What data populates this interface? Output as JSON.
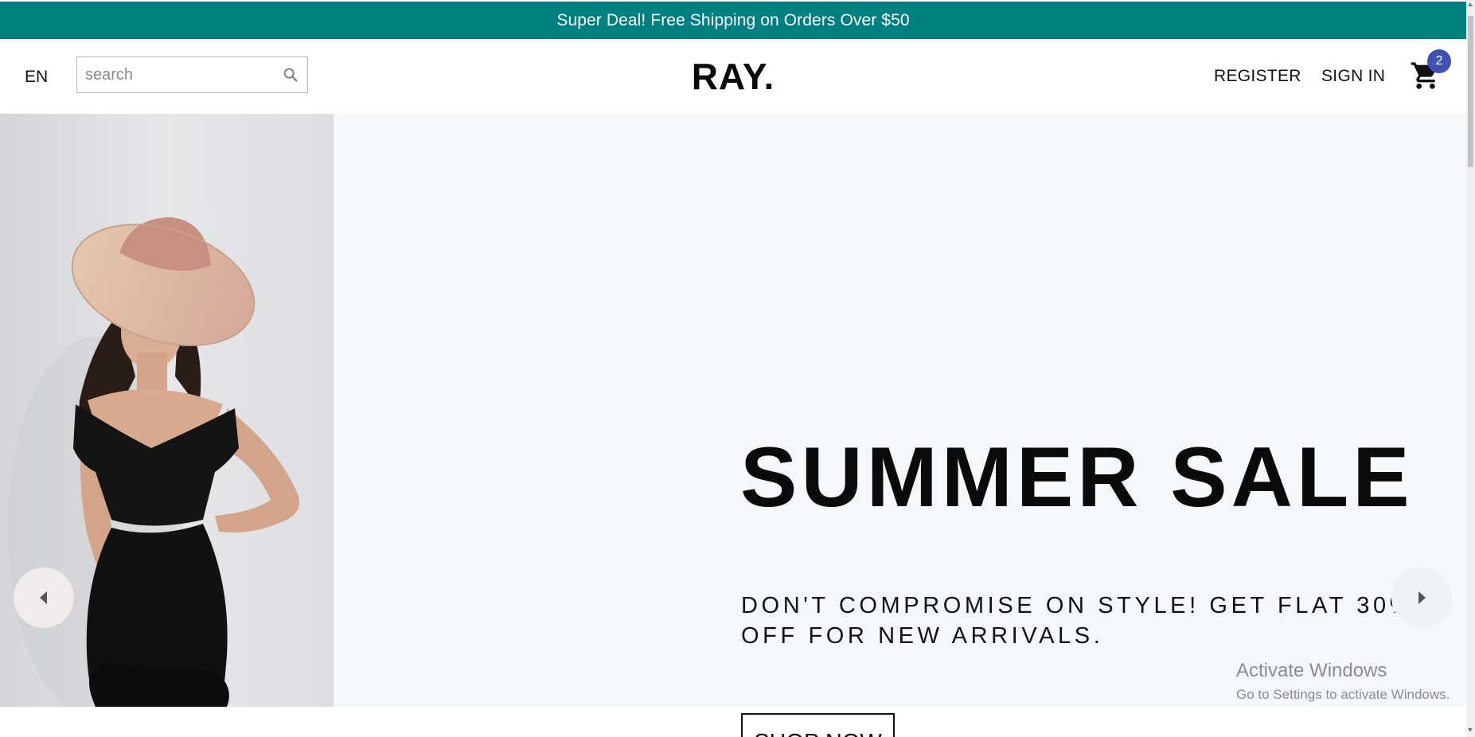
{
  "announcement": {
    "text": "Super Deal! Free Shipping on Orders Over $50"
  },
  "navbar": {
    "language": "EN",
    "search": {
      "placeholder": "search",
      "value": ""
    },
    "logo": "RAY.",
    "links": {
      "register": "REGISTER",
      "sign_in": "SIGN IN"
    },
    "cart": {
      "count": "2",
      "icon": "shopping-cart-icon"
    }
  },
  "hero": {
    "title": "SUMMER SALE",
    "description": "DON'T COMPROMISE ON STYLE! GET FLAT 30% OFF FOR NEW ARRIVALS.",
    "cta": "SHOP NOW",
    "image": "model-in-black-dress-and-sun-hat"
  },
  "watermark": {
    "title": "Activate Windows",
    "subtitle": "Go to Settings to activate Windows."
  },
  "colors": {
    "announcement_bg": "#008080",
    "hero_bg": "#f4f8fa",
    "badge": "#3f51b5",
    "text": "#111111"
  }
}
